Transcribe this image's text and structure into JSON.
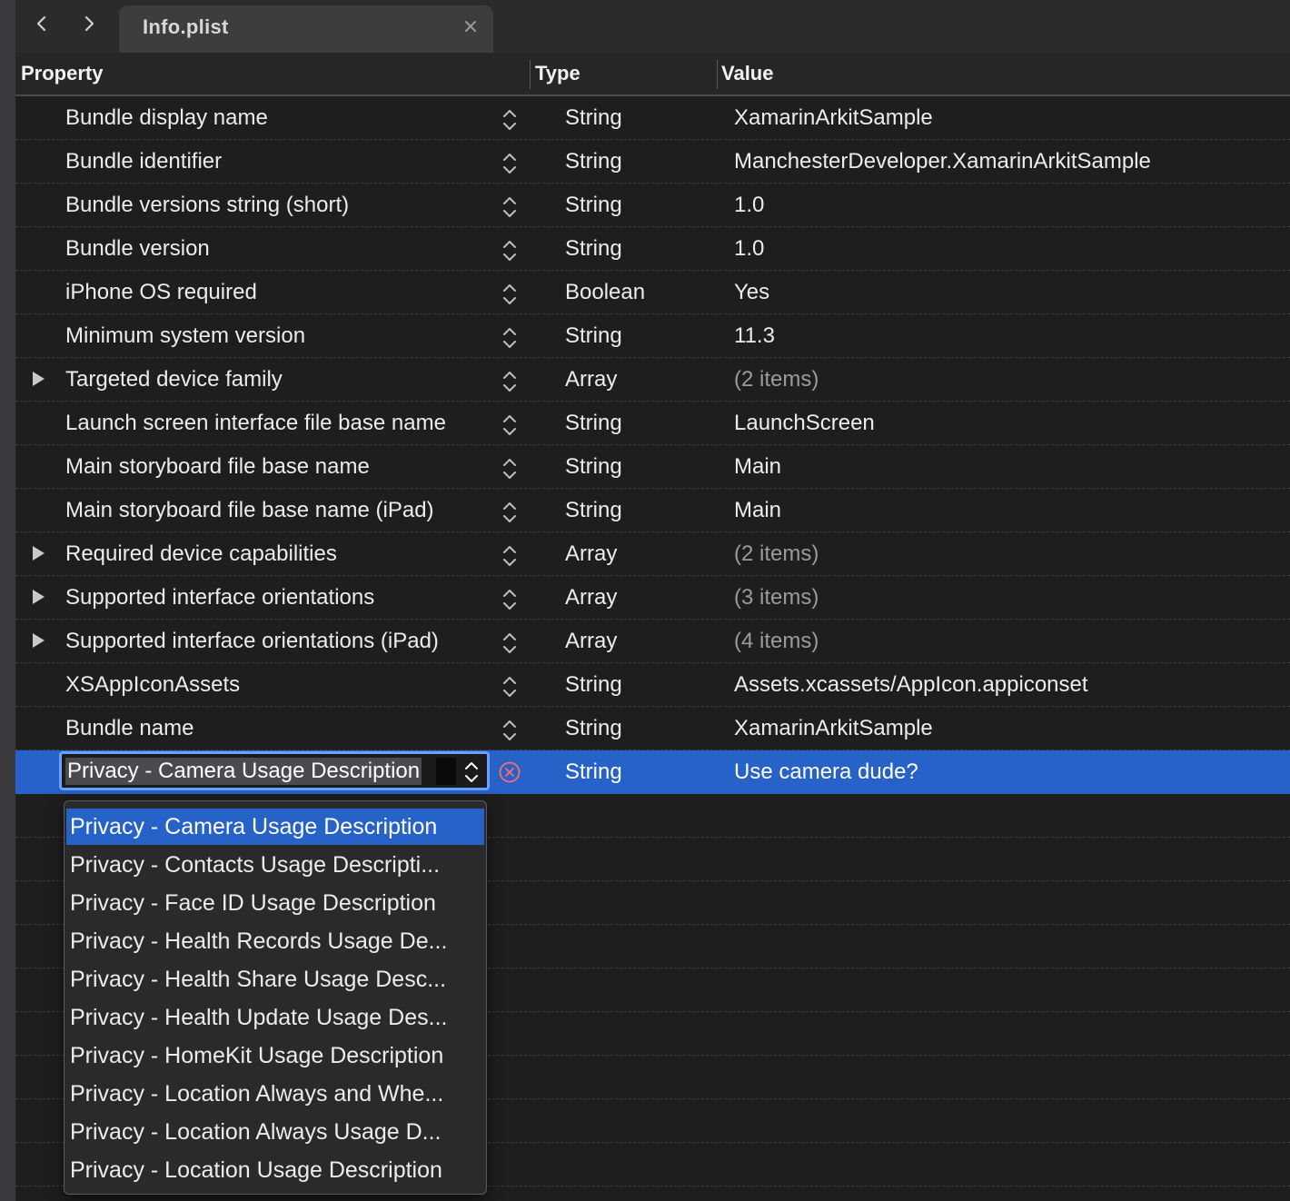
{
  "tab": {
    "title": "Info.plist",
    "back_icon": "chevron-left-icon",
    "forward_icon": "chevron-right-icon",
    "close_icon": "close-icon"
  },
  "columns": {
    "property": "Property",
    "type": "Type",
    "value": "Value"
  },
  "rows": [
    {
      "property": "Bundle display name",
      "type": "String",
      "value": "XamarinArkitSample",
      "expandable": false,
      "muted": false
    },
    {
      "property": "Bundle identifier",
      "type": "String",
      "value": "ManchesterDeveloper.XamarinArkitSample",
      "expandable": false,
      "muted": false
    },
    {
      "property": "Bundle versions string (short)",
      "type": "String",
      "value": "1.0",
      "expandable": false,
      "muted": false
    },
    {
      "property": "Bundle version",
      "type": "String",
      "value": "1.0",
      "expandable": false,
      "muted": false
    },
    {
      "property": "iPhone OS required",
      "type": "Boolean",
      "value": " Yes",
      "expandable": false,
      "muted": false
    },
    {
      "property": "Minimum system version",
      "type": "String",
      "value": "11.3",
      "expandable": false,
      "muted": false
    },
    {
      "property": "Targeted device family",
      "type": "Array",
      "value": "(2 items)",
      "expandable": true,
      "muted": true
    },
    {
      "property": "Launch screen interface file base name",
      "type": "String",
      "value": "LaunchScreen",
      "expandable": false,
      "muted": false
    },
    {
      "property": "Main storyboard file base name",
      "type": "String",
      "value": "Main",
      "expandable": false,
      "muted": false
    },
    {
      "property": "Main storyboard file base name (iPad)",
      "type": "String",
      "value": "Main",
      "expandable": false,
      "muted": false
    },
    {
      "property": "Required device capabilities",
      "type": "Array",
      "value": "(2 items)",
      "expandable": true,
      "muted": true
    },
    {
      "property": "Supported interface orientations",
      "type": "Array",
      "value": "(3 items)",
      "expandable": true,
      "muted": true
    },
    {
      "property": "Supported interface orientations (iPad)",
      "type": "Array",
      "value": "(4 items)",
      "expandable": true,
      "muted": true
    },
    {
      "property": "XSAppIconAssets",
      "type": "String",
      "value": "Assets.xcassets/AppIcon.appiconset",
      "expandable": false,
      "muted": false
    },
    {
      "property": "Bundle name",
      "type": "String",
      "value": "XamarinArkitSample",
      "expandable": false,
      "muted": false
    }
  ],
  "selected_row": {
    "property": "Privacy - Camera Usage Description",
    "type": "String",
    "value": "Use camera dude?",
    "remove_icon": "remove-circle-icon"
  },
  "dropdown": {
    "items": [
      "Privacy - Camera Usage Description",
      "Privacy - Contacts Usage Descripti...",
      "Privacy - Face ID Usage Description",
      "Privacy - Health Records Usage De...",
      "Privacy - Health Share Usage Desc...",
      "Privacy - Health Update Usage Des...",
      "Privacy - HomeKit Usage Description",
      "Privacy - Location Always and Whe...",
      "Privacy - Location Always Usage D...",
      "Privacy - Location Usage Description"
    ],
    "active_index": 0
  },
  "colors": {
    "background": "#1e1e1e",
    "selection": "#2662c8",
    "edit_border": "#6aa0ff",
    "remove": "#ff6b6b"
  }
}
